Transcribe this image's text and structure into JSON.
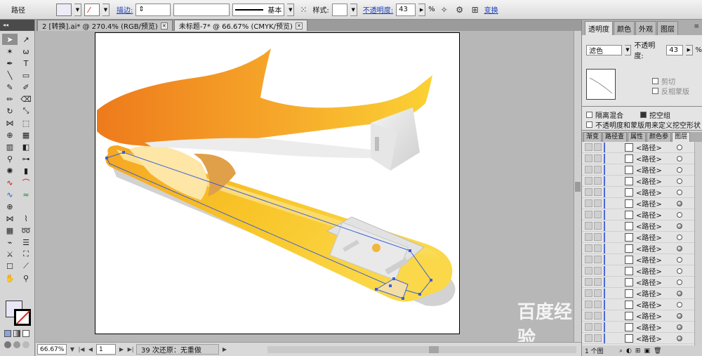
{
  "control_bar": {
    "object_type": "路径",
    "stroke_label": "描边:",
    "stroke_profile": "基本",
    "style_label": "样式:",
    "opacity_label": "不透明度:",
    "opacity_value": "43",
    "opacity_unit": "%",
    "transform_label": "变换"
  },
  "tabs": [
    {
      "label": "2 [转换].ai* @ 270.4% (RGB/预览)"
    },
    {
      "label": "未标题-7* @ 66.67% (CMYK/预览)"
    }
  ],
  "status": {
    "zoom": "66.67%",
    "page": "1",
    "message": "39 次还原：无重做"
  },
  "transparency_panel": {
    "tabs": [
      "透明度",
      "颜色",
      "外观",
      "图层"
    ],
    "blend_mode": "滤色",
    "opacity_label": "不透明度:",
    "opacity_value": "43",
    "opacity_unit": "%",
    "clip_label": "剪切",
    "invert_mask_label": "反相蒙版",
    "isolate_blending_label": "隔离混合",
    "knockout_group_label": "挖空组",
    "opacity_mask_label": "不透明度和蒙版用来定义挖空形状"
  },
  "layers_panel": {
    "tabs": [
      "渐变",
      "路径查",
      "属性",
      "颜色参",
      "图层"
    ],
    "item_label": "<路径>",
    "items": [
      {
        "name": "<路径>",
        "filled": false
      },
      {
        "name": "<路径>",
        "filled": false
      },
      {
        "name": "<路径>",
        "filled": false
      },
      {
        "name": "<路径>",
        "filled": false
      },
      {
        "name": "<路径>",
        "filled": false
      },
      {
        "name": "<路径>",
        "filled": true
      },
      {
        "name": "<路径>",
        "filled": false
      },
      {
        "name": "<路径>",
        "filled": true
      },
      {
        "name": "<路径>",
        "filled": false
      },
      {
        "name": "<路径>",
        "filled": true
      },
      {
        "name": "<路径>",
        "filled": false
      },
      {
        "name": "<路径>",
        "filled": false
      },
      {
        "name": "<路径>",
        "filled": false
      },
      {
        "name": "<路径>",
        "filled": true
      },
      {
        "name": "<路径>",
        "filled": false
      },
      {
        "name": "<路径>",
        "filled": true
      },
      {
        "name": "<路径>",
        "filled": true
      },
      {
        "name": "<路径>",
        "filled": true
      }
    ],
    "footer_count": "1 个图"
  },
  "watermark": "百度经验",
  "colors": {
    "accent": "#1a3fb8",
    "stapler_orange": "#f08a1c",
    "stapler_yellow": "#f8c528",
    "selection_blue": "#3b5fd8"
  },
  "icons": [
    "selection-tool-icon",
    "direct-select-icon",
    "pen-tool-icon",
    "type-tool-icon",
    "gear-icon",
    "target-icon",
    "close-icon",
    "chevron-down-icon",
    "eye-icon",
    "lock-icon",
    "new-layer-icon",
    "trash-icon"
  ]
}
